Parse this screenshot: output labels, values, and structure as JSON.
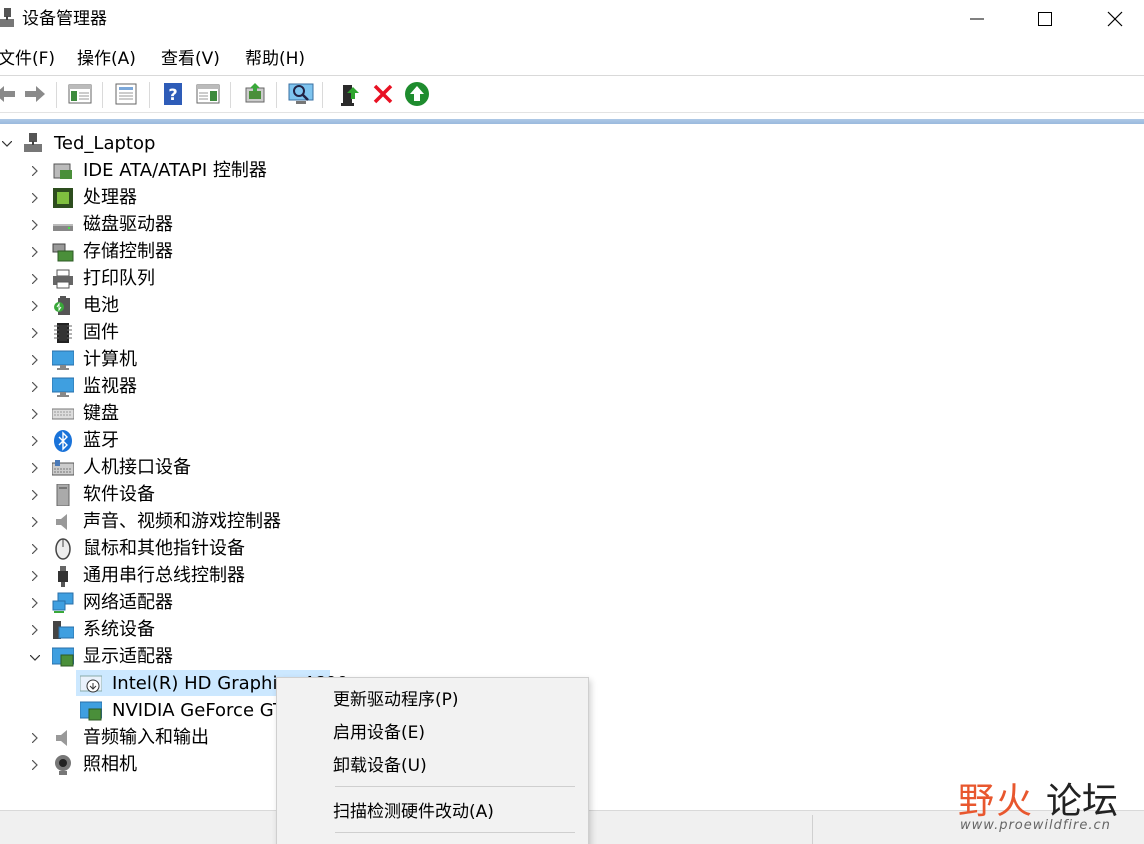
{
  "window": {
    "title": "设备管理器",
    "controls": {
      "minimize": "minimize",
      "maximize": "maximize",
      "close": "close"
    }
  },
  "menubar": {
    "items": [
      "文件(F)",
      "操作(A)",
      "查看(V)",
      "帮助(H)"
    ]
  },
  "toolbar": {
    "buttons": [
      "back-icon",
      "forward-icon",
      "show-hide-console-tree-icon",
      "properties-icon",
      "help-icon",
      "action-pane-icon",
      "update-driver-icon",
      "scan-hardware-icon",
      "enable-device-icon",
      "uninstall-device-icon",
      "enable-device-green-icon"
    ]
  },
  "tree": {
    "root": "Ted_Laptop",
    "categories": [
      "IDE ATA/ATAPI 控制器",
      "处理器",
      "磁盘驱动器",
      "存储控制器",
      "打印队列",
      "电池",
      "固件",
      "计算机",
      "监视器",
      "键盘",
      "蓝牙",
      "人机接口设备",
      "软件设备",
      "声音、视频和游戏控制器",
      "鼠标和其他指针设备",
      "通用串行总线控制器",
      "网络适配器",
      "系统设备",
      "显示适配器",
      "音频输入和输出",
      "照相机"
    ],
    "display_children": [
      "Intel(R) HD Graphics 4600",
      "NVIDIA GeForce GTX"
    ]
  },
  "context_menu": {
    "items": [
      "更新驱动程序(P)",
      "启用设备(E)",
      "卸载设备(U)",
      "扫描检测硬件改动(A)"
    ]
  },
  "watermark": {
    "name_part1": "野火",
    "name_part2": "论坛",
    "url": "www.proewildfire.cn"
  },
  "colors": {
    "selection": "#cce8ff",
    "divider": "#9ab9dd",
    "watermark_accent": "#e8572e",
    "delete_red": "#e81123",
    "enable_green": "#1e8c2e"
  }
}
